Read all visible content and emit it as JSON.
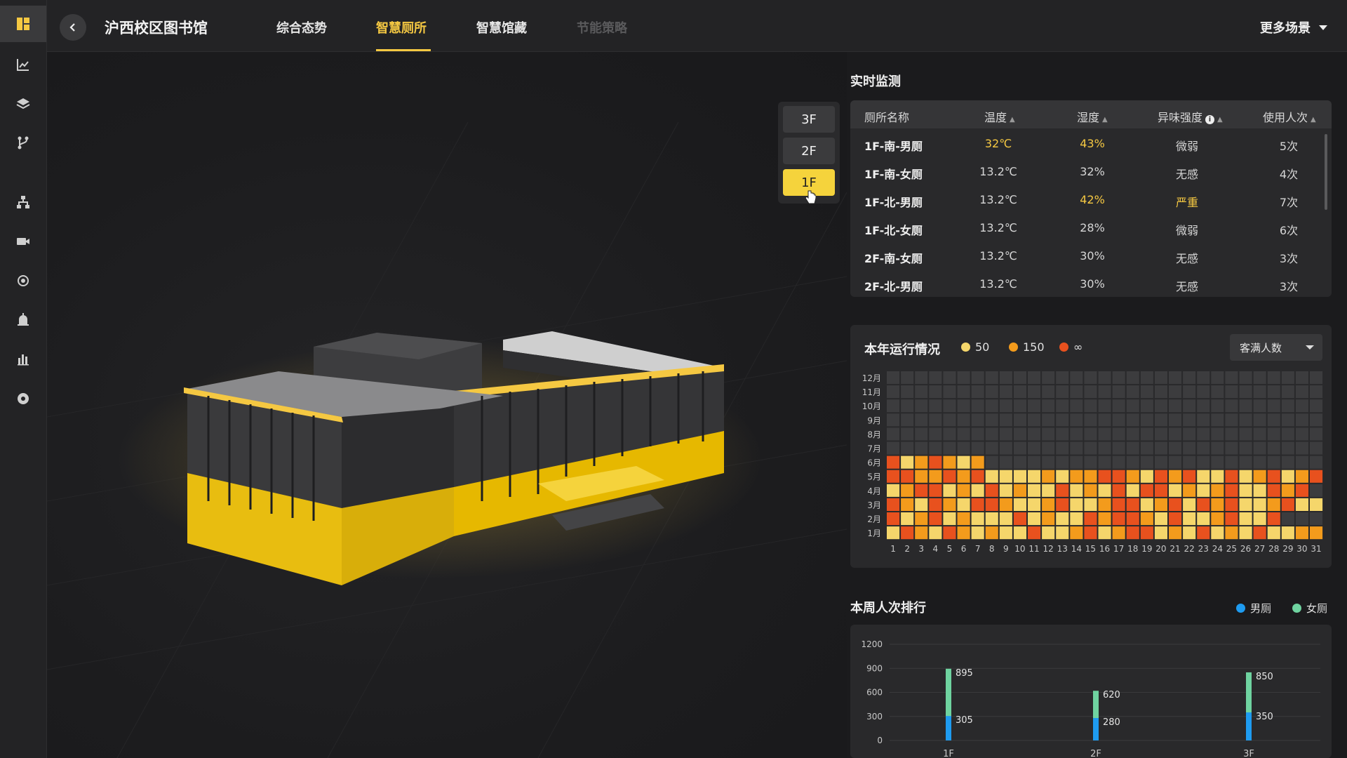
{
  "header": {
    "title": "沪西校区图书馆",
    "tabs": [
      {
        "label": "综合态势",
        "state": "normal"
      },
      {
        "label": "智慧厕所",
        "state": "active"
      },
      {
        "label": "智慧馆藏",
        "state": "normal"
      },
      {
        "label": "节能策略",
        "state": "disabled"
      }
    ],
    "more_label": "更多场景"
  },
  "sidebar": {
    "icons": [
      "dashboard-icon",
      "line-chart-icon",
      "layers-icon",
      "branch-icon",
      "org-chart-icon",
      "video-camera-icon",
      "settings-gear-icon",
      "alarm-icon",
      "bar-chart-icon",
      "disc-icon"
    ]
  },
  "floors": {
    "items": [
      "3F",
      "2F",
      "1F"
    ],
    "selected": "1F"
  },
  "monitor": {
    "title": "实时监测",
    "columns": [
      "厕所名称",
      "温度",
      "湿度",
      "异味强度",
      "使用人次"
    ],
    "rows": [
      {
        "name": "1F-南-男厕",
        "temp": "32℃",
        "humidity": "43%",
        "odor": "微弱",
        "usage": "5次",
        "hl": [
          "temp",
          "humidity"
        ]
      },
      {
        "name": "1F-南-女厕",
        "temp": "13.2℃",
        "humidity": "32%",
        "odor": "无感",
        "usage": "4次",
        "hl": []
      },
      {
        "name": "1F-北-男厕",
        "temp": "13.2℃",
        "humidity": "42%",
        "odor": "严重",
        "usage": "7次",
        "hl": [
          "humidity",
          "odor"
        ]
      },
      {
        "name": "1F-北-女厕",
        "temp": "13.2℃",
        "humidity": "28%",
        "odor": "微弱",
        "usage": "6次",
        "hl": []
      },
      {
        "name": "2F-南-女厕",
        "temp": "13.2℃",
        "humidity": "30%",
        "odor": "无感",
        "usage": "3次",
        "hl": []
      },
      {
        "name": "2F-北-男厕",
        "temp": "13.2℃",
        "humidity": "30%",
        "odor": "无感",
        "usage": "3次",
        "hl": []
      }
    ]
  },
  "yearly": {
    "title": "本年运行情况",
    "legend": [
      {
        "label": "50",
        "color": "#f5d66b"
      },
      {
        "label": "150",
        "color": "#f39b1c"
      },
      {
        "label": "∞",
        "color": "#e8511e"
      }
    ],
    "select_value": "客满人数",
    "months": [
      "12月",
      "11月",
      "10月",
      "9月",
      "8月",
      "7月",
      "6月",
      "5月",
      "4月",
      "3月",
      "2月",
      "1月"
    ],
    "days": [
      "1",
      "2",
      "3",
      "4",
      "5",
      "6",
      "7",
      "8",
      "9",
      "10",
      "11",
      "12",
      "13",
      "14",
      "15",
      "16",
      "17",
      "18",
      "19",
      "20",
      "21",
      "22",
      "23",
      "24",
      "25",
      "26",
      "27",
      "28",
      "29",
      "30",
      "31"
    ],
    "colors": {
      "empty": "#3c3c3e",
      "low": "#f5d66b",
      "mid": "#f39b1c",
      "high": "#e8511e"
    },
    "heat_rows": {
      "6月": "RLMRMLMEEEEEEEEEEEEEEEEEEEEEEEEE",
      "5月": "RRMMRMRLLLLMLMMRRMLRMRLLRLMRLMR",
      "4月": "LMRRLMLRLMLLRLMLRLRRLMLMRLLRMRE",
      "3月": "RMLRMLRRMLLMRLLMRRLMRLRMRLLMRLL",
      "2月": "RLMRLMLLLRLMLLRMRRMLRLLMRLLREE",
      "1月": "LRMLRMLMLLRLLMRLMRRLMLRLMLRLLMM"
    }
  },
  "weekly": {
    "title": "本周人次排行",
    "legend": [
      {
        "label": "男厕",
        "color": "#1e9bf0"
      },
      {
        "label": "女厕",
        "color": "#6fd3a0"
      }
    ],
    "y_ticks": [
      "1200",
      "900",
      "600",
      "300",
      "0"
    ],
    "categories": [
      "1F",
      "2F",
      "3F"
    ]
  },
  "chart_data": {
    "type": "bar",
    "title": "本周人次排行",
    "categories": [
      "1F",
      "2F",
      "3F"
    ],
    "series": [
      {
        "name": "男厕",
        "values": [
          305,
          280,
          350
        ]
      },
      {
        "name": "女厕",
        "values": [
          895,
          620,
          850
        ]
      }
    ],
    "ylim": [
      0,
      1200
    ],
    "yticks": [
      0,
      300,
      600,
      900,
      1200
    ]
  }
}
